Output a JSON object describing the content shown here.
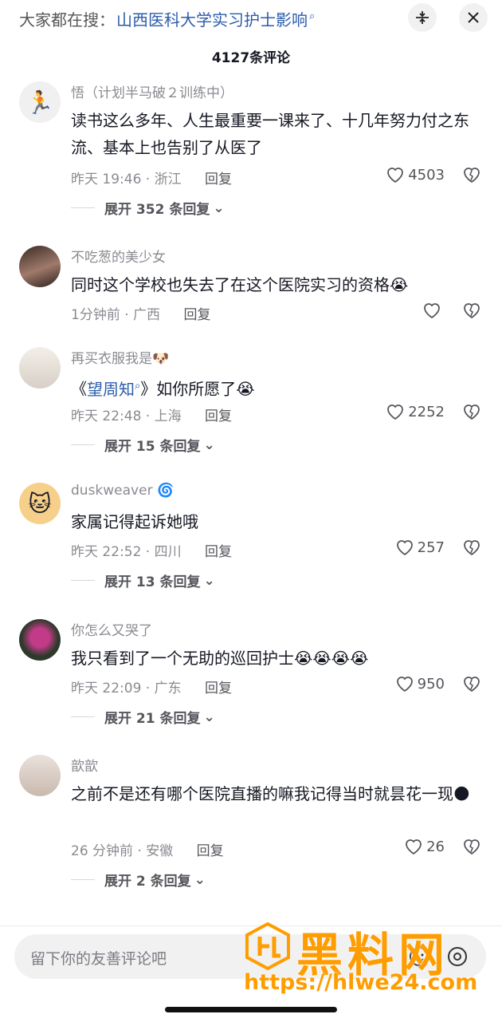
{
  "header": {
    "search_prefix": "大家都在搜：",
    "search_term": "山西医科大学实习护士影响",
    "comment_count": "4127条评论"
  },
  "comments": [
    {
      "username": "悟（计划半马破２训练中）",
      "text": "读书这么多年、人生最重要一课来了、十几年努力付之东流、基本上也告别了从医了",
      "time": "昨天 19:46",
      "location": "浙江",
      "reply": "回复",
      "likes": "4503",
      "expand": "展开 352 条回复",
      "avatar_emoji": "🏃"
    },
    {
      "username": "不吃葱的美少女",
      "text": "同时这个学校也失去了在这个医院实习的资格😭",
      "time": "1分钟前",
      "location": "广西",
      "reply": "回复",
      "likes": "",
      "expand": "",
      "avatar_emoji": ""
    },
    {
      "username": "再买衣服我是🐶",
      "text_prefix": "《",
      "text_link": "望周知",
      "text_suffix": "》如你所愿了😭",
      "time": "昨天 22:48",
      "location": "上海",
      "reply": "回复",
      "likes": "2252",
      "expand": "展开 15 条回复",
      "avatar_emoji": ""
    },
    {
      "username": "duskweaver 🌀",
      "text": "家属记得起诉她哦",
      "time": "昨天 22:52",
      "location": "四川",
      "reply": "回复",
      "likes": "257",
      "expand": "展开 13 条回复",
      "avatar_emoji": "🐱"
    },
    {
      "username": "你怎么又哭了",
      "text": "我只看到了一个无助的巡回护士😭😭😭😭",
      "time": "昨天 22:09",
      "location": "广东",
      "reply": "回复",
      "likes": "950",
      "expand": "展开 21 条回复",
      "avatar_emoji": ""
    },
    {
      "username": "歆歆",
      "text": "之前不是还有哪个医院直播的嘛我记得当时就昙花一现🌑",
      "time": "26 分钟前",
      "location": "安徽",
      "reply": "回复",
      "likes": "26",
      "expand": "展开 2 条回复",
      "avatar_emoji": ""
    }
  ],
  "input": {
    "placeholder": "留下你的友善评论吧"
  },
  "watermark": {
    "brand": "黑料网",
    "url": "https://hlwe24.com"
  },
  "colors": {
    "link": "#2b5cab",
    "watermark": "#ff9d00",
    "muted": "#8a8b91"
  }
}
